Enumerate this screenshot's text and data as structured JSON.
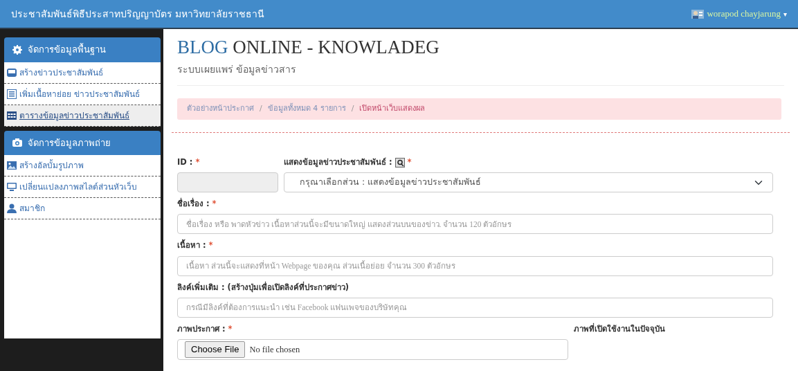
{
  "navbar": {
    "brand": "ประชาสัมพันธ์พิธีประสาทปริญญาบัตร มหาวิทยาลัยราชธานี",
    "user": "worapod chayjarung",
    "user_caret": "▾"
  },
  "sidebar": [
    {
      "title": "จัดการข้อมูลพื้นฐาน",
      "kind": "settings",
      "items": [
        {
          "label": "สร้างข่าวประชาสัมพันธ์",
          "kind": "inbox",
          "selected": false
        },
        {
          "label": "เพิ่มเนื้อหาย่อย ข่าวประชาสัมพันธ์",
          "kind": "list",
          "selected": false
        },
        {
          "label": "ตารางข้อมูลข่าวประชาสัมพันธ์",
          "kind": "table",
          "selected": true
        }
      ]
    },
    {
      "title": "จัดการข้อมูลภาพถ่าย",
      "kind": "photo",
      "items": [
        {
          "label": "สร้างอัลบั้มรูปภาพ",
          "kind": "album",
          "selected": false
        },
        {
          "label": "เปลี่ยนแปลงภาพสไลด์ส่วนหัวเว็บ",
          "kind": "slides",
          "selected": false
        },
        {
          "label": "สมาชิก",
          "kind": "member",
          "selected": false
        }
      ]
    }
  ],
  "header": {
    "title_accent": "BLOG",
    "title_rest": "ONLINE - KNOWLADEG",
    "subtitle": "ระบบเผยแพร่ ข้อมูลข่าวสาร"
  },
  "breadcrumb": [
    {
      "label": "ตัวอย่างหน้าประกาศ",
      "selected": false
    },
    {
      "label": "ข้อมูลทั้งหมด 4 รายการ",
      "selected": false
    },
    {
      "label": "เปิดหน้าเว็บแสดงผล",
      "selected": true
    }
  ],
  "breadcrumb_separator": "/",
  "form": {
    "required_mark": "*",
    "id_field": {
      "label": "ID :",
      "required": true,
      "disabled": true
    },
    "category": {
      "label": "แสดงข้อมูลข่าวประชาสัมพันธ์ :",
      "required": true,
      "value": "กรุณาเลือกส่วน : แสดงข้อมูลข่าวประชาสัมพันธ์"
    },
    "fields": [
      {
        "label": "ชื่อเรื่อง :",
        "required": true,
        "placeholder": "ชื่อเรื่อง หรือ พาดหัวข่าว เนื้อหาส่วนนี้จะมีขนาดใหญ่ แสดงส่วนบนของข่าว. จำนวน 120 ตัวอักษร"
      },
      {
        "label": "เนื้อหา :",
        "required": true,
        "placeholder": "เนื้อหา ส่วนนี้จะแสดงที่หน้า Webpage ของคุณ ส่วนเนื้อย่อย จำนวน 300 ตัวอักษร"
      },
      {
        "label": "ลิงค์เพิ่มเติม : (สร้างปุ่มเพื่อเปิดลิงค์ที่ประกาศข่าว)",
        "required": false,
        "placeholder": "กรณีมีลิงค์ที่ต้องการแนะนำ เช่น Facebook แฟนเพจของบริษัทคุณ"
      }
    ],
    "image": {
      "label": "ภาพประกาศ :",
      "required": true,
      "button": "Choose File",
      "status": "No file chosen"
    },
    "current_image_label": "ภาพที่เปิดใช้งานในปัจจุบัน"
  }
}
